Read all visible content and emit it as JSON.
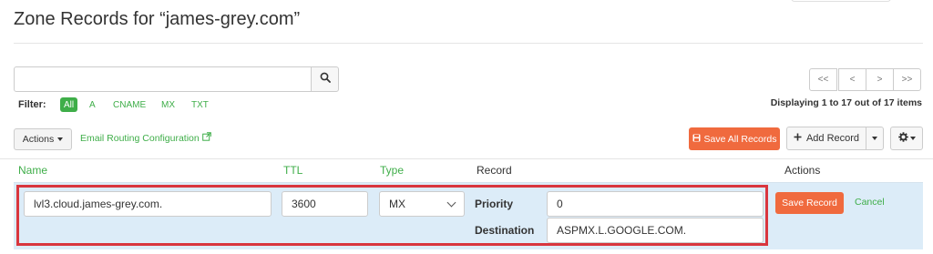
{
  "page": {
    "title": "Zone Records for “james-grey.com”"
  },
  "search": {
    "value": "",
    "placeholder": "",
    "button_icon": "search-icon"
  },
  "pagination": {
    "first_label": "<<",
    "prev_label": "<",
    "next_label": ">",
    "last_label": ">>",
    "displaying_text": "Displaying 1 to 17 out of 17 items"
  },
  "filter": {
    "label": "Filter:",
    "options": [
      "All",
      "A",
      "CNAME",
      "MX",
      "TXT"
    ],
    "active": "All"
  },
  "toolbar": {
    "actions_label": "Actions",
    "email_routing_label": "Email Routing Configuration",
    "save_all_label": "Save All Records",
    "add_record_label": "Add Record"
  },
  "table": {
    "headers": {
      "name": "Name",
      "ttl": "TTL",
      "type": "Type",
      "record": "Record",
      "actions": "Actions"
    },
    "edit_row": {
      "name": "lvl3.cloud.james-grey.com.",
      "ttl": "3600",
      "type": "MX",
      "priority_label": "Priority",
      "priority_value": "0",
      "destination_label": "Destination",
      "destination_value": "ASPMX.L.GOOGLE.COM.",
      "save_label": "Save Record",
      "cancel_label": "Cancel"
    }
  },
  "colors": {
    "accent_green": "#3fae49",
    "accent_orange": "#f06a3e",
    "row_highlight": "#dcecf8",
    "annotation_red": "#d9363e"
  }
}
